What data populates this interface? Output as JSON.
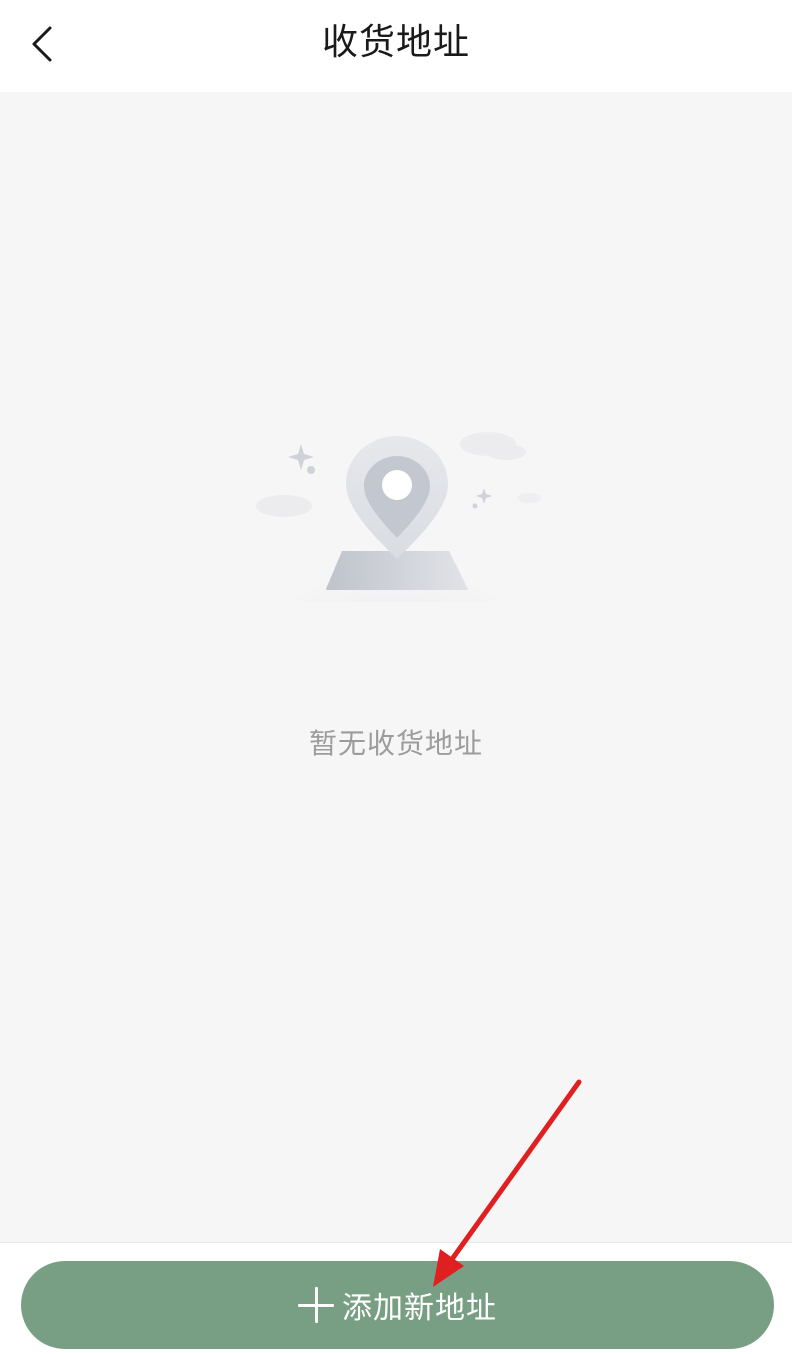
{
  "header": {
    "title": "收货地址",
    "back_icon": "chevron-left-icon"
  },
  "empty_state": {
    "illustration_icon": "map-pin-icon",
    "message": "暂无收货地址"
  },
  "footer": {
    "add_button_label": "添加新地址",
    "add_button_icon": "plus-icon",
    "add_button_color": "#789f83"
  },
  "annotation": {
    "arrow_color": "#e02020"
  }
}
